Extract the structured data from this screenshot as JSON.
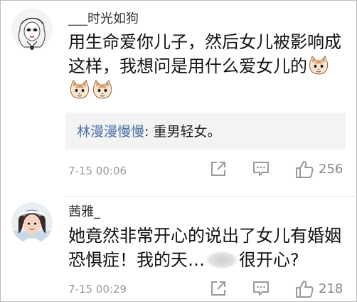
{
  "comments": [
    {
      "username": "___时光如狗",
      "avatar": "sketch-girl-avatar",
      "content_line1": "用生命爱你儿子，然后女儿被影响成",
      "content_line2": "这样，我想问是用什么爱女儿的",
      "emoji": "cat-face-emoji",
      "reply": {
        "author": "林漫漫慢慢",
        "text": ": 重男轻女。"
      },
      "time": "7-15 00:06",
      "likes": "256"
    },
    {
      "username": "茜雅_",
      "avatar": "photo-girl-avatar",
      "content_line1": "她竟然非常开心的说出了女儿有婚姻",
      "content_line2_a": "恐惧症！我的天…",
      "content_line2_b": "很开心?",
      "time": "7-15 00:29",
      "likes": "218"
    }
  ],
  "colors": {
    "reply_author": "#4a6ea8",
    "meta_gray": "#999999",
    "reply_bg": "#f3f3f3"
  },
  "icons": [
    "share-icon",
    "comment-icon",
    "thumbs-up-icon"
  ]
}
